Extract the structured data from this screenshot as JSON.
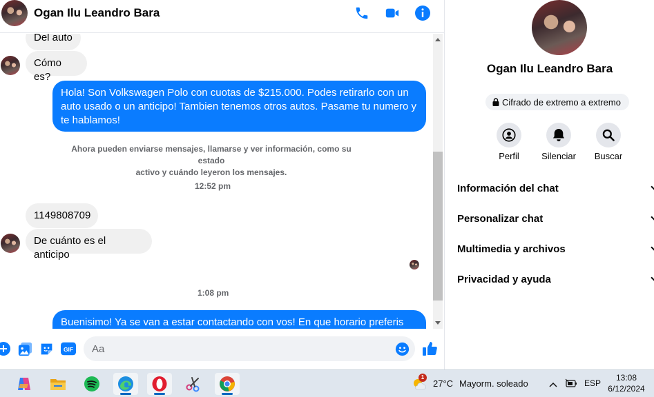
{
  "header": {
    "contact_name": "Ogan Ilu Leandro Bara"
  },
  "messages": {
    "m1_in": "Del auto",
    "m2_in": "Cómo es?",
    "m3_out": [
      "Hola! Son Volkswagen Polo con cuotas de $215.000. Podes retirarlo con un",
      "auto usado o un anticipo! Tambien tenemos otros autos. Pasame tu numero y",
      "te hablamos!"
    ],
    "system_note": [
      "Ahora pueden enviarse mensajes, llamarse y ver información, como su estado",
      "activo y cuándo leyeron los mensajes."
    ],
    "time_1": "12:52 pm",
    "m4_in": "1149808709",
    "m5_in": "De cuánto es el anticipo",
    "time_2": "1:08 pm",
    "m6_out": "Buenisimo! Ya se van a estar contactando con vos! En que horario preferis que"
  },
  "composer": {
    "placeholder": "Aa"
  },
  "panel": {
    "name": "Ogan Ilu Leandro Bara",
    "encryption": "Cifrado de extremo a extremo",
    "actions": [
      {
        "label": "Perfil"
      },
      {
        "label": "Silenciar"
      },
      {
        "label": "Buscar"
      }
    ],
    "sections": [
      {
        "label": "Información del chat"
      },
      {
        "label": "Personalizar chat"
      },
      {
        "label": "Multimedia y archivos"
      },
      {
        "label": "Privacidad y ayuda"
      }
    ]
  },
  "taskbar": {
    "weather_badge": "1",
    "temperature": "27°C",
    "weather": "Mayorm. soleado",
    "language": "ESP",
    "time": "13:08",
    "date": "6/12/2024"
  },
  "colors": {
    "accent": "#0a7cff",
    "incoming_bubble": "#f0f0f0",
    "muted_text": "#65676b"
  }
}
